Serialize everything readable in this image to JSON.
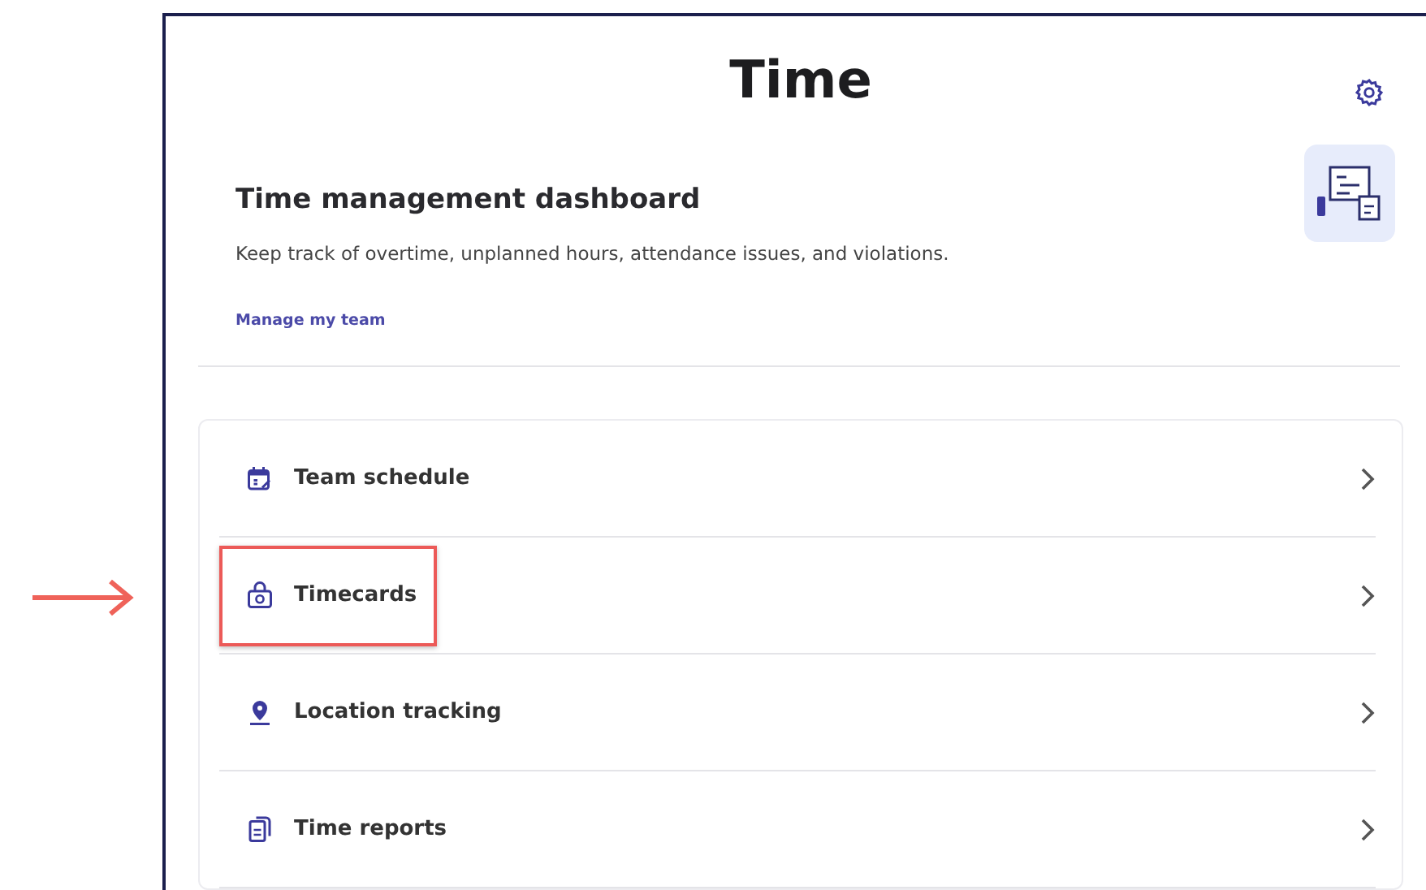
{
  "header": {
    "title": "Time"
  },
  "dashboard": {
    "title": "Time management dashboard",
    "description": "Keep track of overtime, unplanned hours, attendance issues, and violations.",
    "link": "Manage my team"
  },
  "menu": [
    {
      "kind": "schedule",
      "label": "Team schedule",
      "highlighted": false
    },
    {
      "kind": "timecard",
      "label": "Timecards",
      "highlighted": true
    },
    {
      "kind": "location",
      "label": "Location tracking",
      "highlighted": false
    },
    {
      "kind": "report",
      "label": "Time reports",
      "highlighted": false
    }
  ]
}
